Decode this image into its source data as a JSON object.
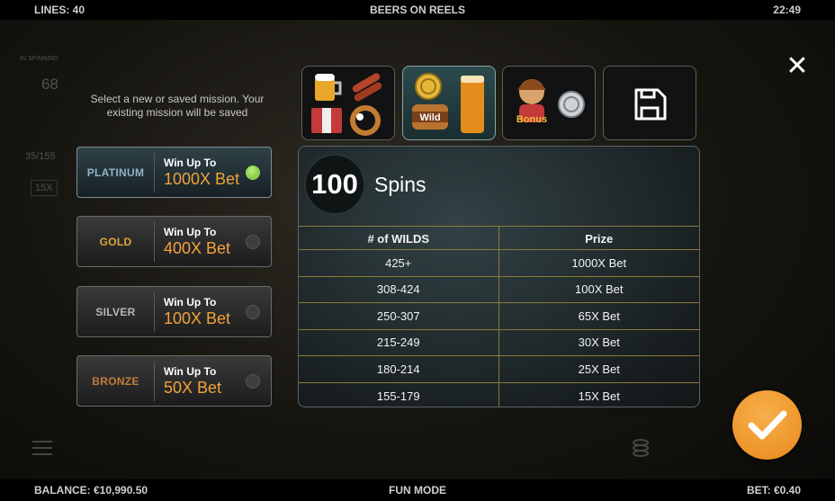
{
  "topbar": {
    "lines": "LINES: 40",
    "title": "BEERS ON REELS",
    "clock": "22:49"
  },
  "bottombar": {
    "balance": "BALANCE: €10,990.50",
    "mode": "FUN MODE",
    "bet": "BET: €0.40"
  },
  "background_hud": {
    "label": "IN SPINNING",
    "count": "68",
    "progress": "35/155",
    "multiplier": "15X"
  },
  "intro": "Select a new or saved mission. Your existing mission will be saved",
  "missions": [
    {
      "tier": "PLATINUM",
      "win_label": "Win Up To",
      "win_value": "1000X Bet",
      "selected": true,
      "tier_color": "#8fb3c4"
    },
    {
      "tier": "GOLD",
      "win_label": "Win Up To",
      "win_value": "400X Bet",
      "selected": false,
      "tier_color": "#e0a43a"
    },
    {
      "tier": "SILVER",
      "win_label": "Win Up To",
      "win_value": "100X Bet",
      "selected": false,
      "tier_color": "#b8b8b8"
    },
    {
      "tier": "BRONZE",
      "win_label": "Win Up To",
      "win_value": "50X Bet",
      "selected": false,
      "tier_color": "#c27a3a"
    }
  ],
  "tabs": [
    {
      "name": "symbols-tab",
      "icons": [
        "beer-mug-icon",
        "sausages-icon",
        "accordion-icon",
        "pretzel-icon"
      ],
      "active": false
    },
    {
      "name": "wilds-tab",
      "icons": [
        "gold-coin-icon",
        "wild-barrel-icon",
        "beer-glass-icon"
      ],
      "label": "Wild",
      "active": true
    },
    {
      "name": "bonus-tab",
      "icons": [
        "barmaid-icon",
        "silver-coin-icon"
      ],
      "label": "Bonus",
      "active": false
    },
    {
      "name": "saved-tab",
      "icons": [
        "save-icon"
      ],
      "active": false
    }
  ],
  "panel": {
    "spins_count": "100",
    "spins_label": "Spins",
    "headers": [
      "# of WILDS",
      "Prize"
    ],
    "rows": [
      [
        "425+",
        "1000X Bet"
      ],
      [
        "308-424",
        "100X Bet"
      ],
      [
        "250-307",
        "65X Bet"
      ],
      [
        "215-249",
        "30X Bet"
      ],
      [
        "180-214",
        "25X Bet"
      ],
      [
        "155-179",
        "15X Bet"
      ]
    ]
  },
  "colors": {
    "accent_orange": "#f2a33a",
    "confirm": "#ef9a2a",
    "selected_dot": "#8fd14f",
    "table_line": "#8a7a3a"
  }
}
